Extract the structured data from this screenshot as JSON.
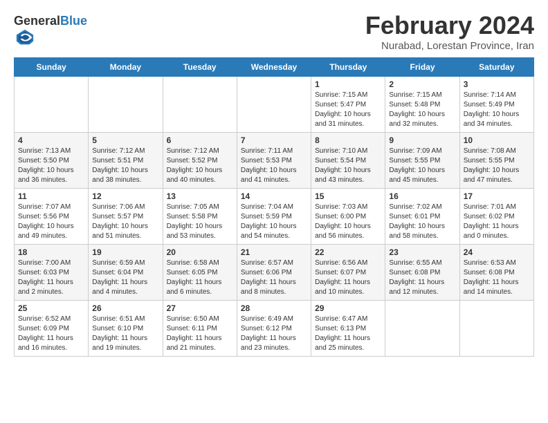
{
  "header": {
    "logo_general": "General",
    "logo_blue": "Blue",
    "title": "February 2024",
    "location": "Nurabad, Lorestan Province, Iran"
  },
  "days_of_week": [
    "Sunday",
    "Monday",
    "Tuesday",
    "Wednesday",
    "Thursday",
    "Friday",
    "Saturday"
  ],
  "weeks": [
    [
      {
        "day": "",
        "info": ""
      },
      {
        "day": "",
        "info": ""
      },
      {
        "day": "",
        "info": ""
      },
      {
        "day": "",
        "info": ""
      },
      {
        "day": "1",
        "info": "Sunrise: 7:15 AM\nSunset: 5:47 PM\nDaylight: 10 hours\nand 31 minutes."
      },
      {
        "day": "2",
        "info": "Sunrise: 7:15 AM\nSunset: 5:48 PM\nDaylight: 10 hours\nand 32 minutes."
      },
      {
        "day": "3",
        "info": "Sunrise: 7:14 AM\nSunset: 5:49 PM\nDaylight: 10 hours\nand 34 minutes."
      }
    ],
    [
      {
        "day": "4",
        "info": "Sunrise: 7:13 AM\nSunset: 5:50 PM\nDaylight: 10 hours\nand 36 minutes."
      },
      {
        "day": "5",
        "info": "Sunrise: 7:12 AM\nSunset: 5:51 PM\nDaylight: 10 hours\nand 38 minutes."
      },
      {
        "day": "6",
        "info": "Sunrise: 7:12 AM\nSunset: 5:52 PM\nDaylight: 10 hours\nand 40 minutes."
      },
      {
        "day": "7",
        "info": "Sunrise: 7:11 AM\nSunset: 5:53 PM\nDaylight: 10 hours\nand 41 minutes."
      },
      {
        "day": "8",
        "info": "Sunrise: 7:10 AM\nSunset: 5:54 PM\nDaylight: 10 hours\nand 43 minutes."
      },
      {
        "day": "9",
        "info": "Sunrise: 7:09 AM\nSunset: 5:55 PM\nDaylight: 10 hours\nand 45 minutes."
      },
      {
        "day": "10",
        "info": "Sunrise: 7:08 AM\nSunset: 5:55 PM\nDaylight: 10 hours\nand 47 minutes."
      }
    ],
    [
      {
        "day": "11",
        "info": "Sunrise: 7:07 AM\nSunset: 5:56 PM\nDaylight: 10 hours\nand 49 minutes."
      },
      {
        "day": "12",
        "info": "Sunrise: 7:06 AM\nSunset: 5:57 PM\nDaylight: 10 hours\nand 51 minutes."
      },
      {
        "day": "13",
        "info": "Sunrise: 7:05 AM\nSunset: 5:58 PM\nDaylight: 10 hours\nand 53 minutes."
      },
      {
        "day": "14",
        "info": "Sunrise: 7:04 AM\nSunset: 5:59 PM\nDaylight: 10 hours\nand 54 minutes."
      },
      {
        "day": "15",
        "info": "Sunrise: 7:03 AM\nSunset: 6:00 PM\nDaylight: 10 hours\nand 56 minutes."
      },
      {
        "day": "16",
        "info": "Sunrise: 7:02 AM\nSunset: 6:01 PM\nDaylight: 10 hours\nand 58 minutes."
      },
      {
        "day": "17",
        "info": "Sunrise: 7:01 AM\nSunset: 6:02 PM\nDaylight: 11 hours\nand 0 minutes."
      }
    ],
    [
      {
        "day": "18",
        "info": "Sunrise: 7:00 AM\nSunset: 6:03 PM\nDaylight: 11 hours\nand 2 minutes."
      },
      {
        "day": "19",
        "info": "Sunrise: 6:59 AM\nSunset: 6:04 PM\nDaylight: 11 hours\nand 4 minutes."
      },
      {
        "day": "20",
        "info": "Sunrise: 6:58 AM\nSunset: 6:05 PM\nDaylight: 11 hours\nand 6 minutes."
      },
      {
        "day": "21",
        "info": "Sunrise: 6:57 AM\nSunset: 6:06 PM\nDaylight: 11 hours\nand 8 minutes."
      },
      {
        "day": "22",
        "info": "Sunrise: 6:56 AM\nSunset: 6:07 PM\nDaylight: 11 hours\nand 10 minutes."
      },
      {
        "day": "23",
        "info": "Sunrise: 6:55 AM\nSunset: 6:08 PM\nDaylight: 11 hours\nand 12 minutes."
      },
      {
        "day": "24",
        "info": "Sunrise: 6:53 AM\nSunset: 6:08 PM\nDaylight: 11 hours\nand 14 minutes."
      }
    ],
    [
      {
        "day": "25",
        "info": "Sunrise: 6:52 AM\nSunset: 6:09 PM\nDaylight: 11 hours\nand 16 minutes."
      },
      {
        "day": "26",
        "info": "Sunrise: 6:51 AM\nSunset: 6:10 PM\nDaylight: 11 hours\nand 19 minutes."
      },
      {
        "day": "27",
        "info": "Sunrise: 6:50 AM\nSunset: 6:11 PM\nDaylight: 11 hours\nand 21 minutes."
      },
      {
        "day": "28",
        "info": "Sunrise: 6:49 AM\nSunset: 6:12 PM\nDaylight: 11 hours\nand 23 minutes."
      },
      {
        "day": "29",
        "info": "Sunrise: 6:47 AM\nSunset: 6:13 PM\nDaylight: 11 hours\nand 25 minutes."
      },
      {
        "day": "",
        "info": ""
      },
      {
        "day": "",
        "info": ""
      }
    ]
  ]
}
